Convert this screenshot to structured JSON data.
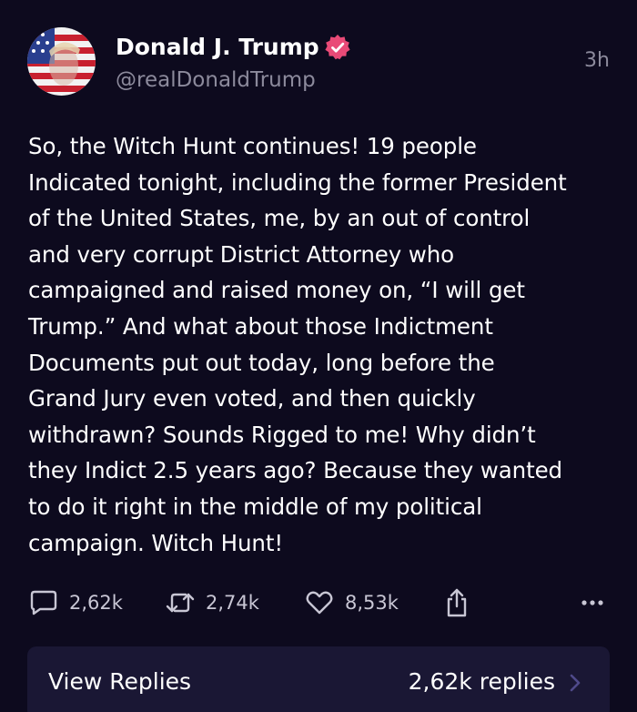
{
  "author": {
    "display_name": "Donald J. Trump",
    "handle": "@realDonaldTrump",
    "verified": true,
    "verified_color": "#e94a77"
  },
  "timestamp": "3h",
  "post_lines": [
    "So, the Witch Hunt continues! 19 people",
    "Indicated tonight, including the former President",
    "of the United States, me, by an out of control",
    "and very corrupt District Attorney who",
    "campaigned and raised money on, “I will get",
    "Trump.” And what about those Indictment",
    "Documents put out today, long before the",
    "Grand Jury even voted, and then quickly",
    "withdrawn? Sounds Rigged to me! Why didn’t",
    "they Indict 2.5 years ago? Because they wanted",
    "to do it right in the middle of my political",
    "campaign. Witch Hunt!"
  ],
  "actions": {
    "reply": {
      "icon": "reply-icon",
      "count": "2,62k"
    },
    "repost": {
      "icon": "repost-icon",
      "count": "2,74k"
    },
    "like": {
      "icon": "heart-icon",
      "count": "8,53k"
    },
    "share": {
      "icon": "share-icon"
    },
    "more": {
      "icon": "more-icon"
    }
  },
  "replies_bar": {
    "label": "View Replies",
    "count_text": "2,62k replies"
  },
  "colors": {
    "background": "#0d0a1e",
    "secondary_text": "#8c8a9c",
    "replies_bar": "#1a1734",
    "accent": "#6b5fd8"
  }
}
